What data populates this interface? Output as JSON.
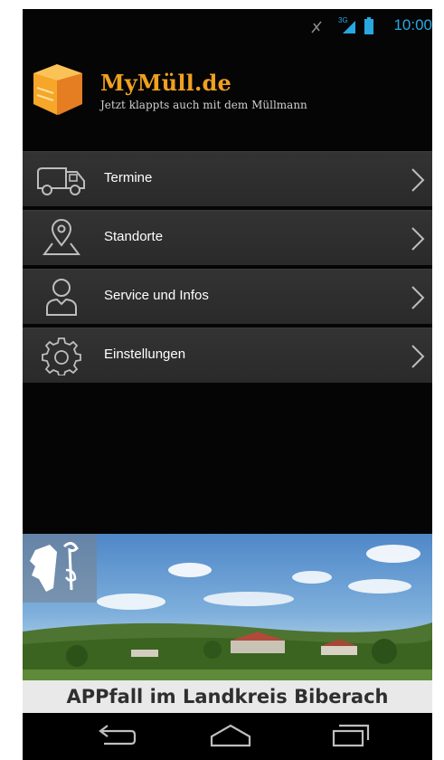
{
  "status_bar": {
    "time": "10:00",
    "network": "3G"
  },
  "header": {
    "title": "MyMüll.de",
    "subtitle": "Jetzt klappts auch mit dem Müllmann"
  },
  "menu": {
    "items": [
      {
        "label": "Termine",
        "icon": "truck-icon"
      },
      {
        "label": "Standorte",
        "icon": "location-pin-icon"
      },
      {
        "label": "Service und Infos",
        "icon": "person-icon"
      },
      {
        "label": "Einstellungen",
        "icon": "gear-icon"
      }
    ]
  },
  "banner": {
    "caption": "APPfall im Landkreis Biberach"
  },
  "colors": {
    "accent": "#f0a01f",
    "status": "#29a7e1",
    "menu_bg": "#2e2e2e",
    "background": "#050506"
  }
}
